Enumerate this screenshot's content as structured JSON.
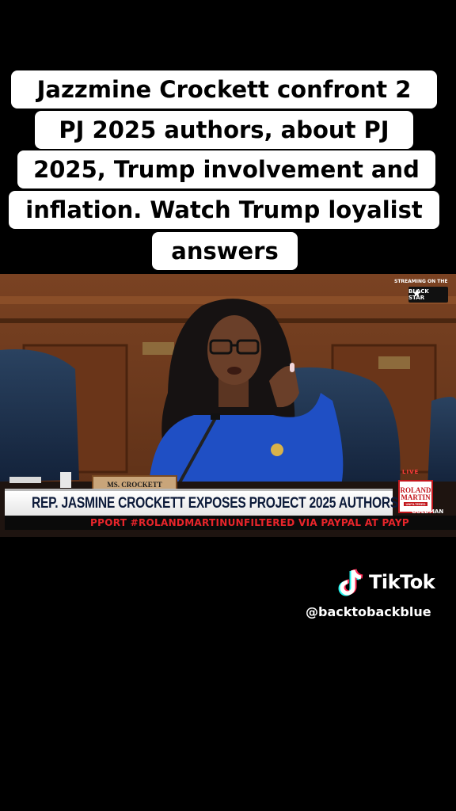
{
  "caption": {
    "lines": [
      "Jazzmine Crockett confront 2",
      "PJ 2025 authors, about PJ",
      "2025, Trump involvement and",
      "inflation. Watch Trump loyalist",
      "answers"
    ]
  },
  "video": {
    "streaming_label": "STREAMING ON THE",
    "network_logo_text": "BLACK STAR",
    "nameplate": "MS. CROCKETT",
    "live_tag": "LIVE",
    "lower_third": "REP. JASMINE CROCKETT EXPOSES PROJECT 2025 AUTHORS",
    "show_logo": {
      "line1": "ROLAND",
      "line2": "MARTIN",
      "line3": "UNFILTERED"
    },
    "guest_name": "GOLDMAN",
    "ticker": "PPORT #ROLANDMARTINUNFILTERED VIA PAYPAL AT PAYP"
  },
  "watermark": {
    "brand": "TikTok",
    "icon": "tiktok-note-icon",
    "username": "@backtobackblue"
  },
  "colors": {
    "background": "#000000",
    "caption_bg": "#ffffff",
    "ticker_text": "#e8252b",
    "lower_third_text": "#0d1b3a",
    "suit_blue": "#1f4fc4"
  }
}
